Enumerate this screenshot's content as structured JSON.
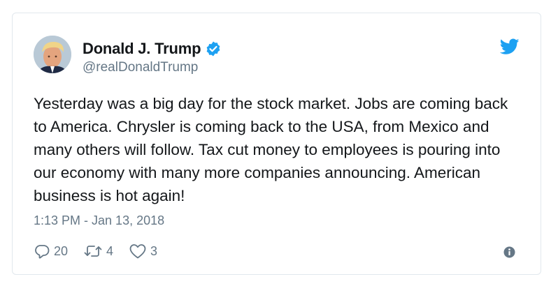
{
  "tweet": {
    "display_name": "Donald J. Trump",
    "handle": "@realDonaldTrump",
    "verified": true,
    "text": "Yesterday was a big day for the stock market. Jobs are coming back to America. Chrysler is coming back to the USA, from Mexico and many others will follow. Tax cut money to employees is pouring into our economy with many more companies announcing. American business is hot again!",
    "timestamp": "1:13 PM - Jan 13, 2018"
  },
  "actions": {
    "reply_count": "20",
    "retweet_count": "4",
    "like_count": "3"
  },
  "icons": {
    "brand": "twitter-bird-icon",
    "verified": "verified-badge-icon",
    "reply": "reply-icon",
    "retweet": "retweet-icon",
    "like": "heart-icon",
    "info": "info-icon"
  },
  "colors": {
    "accent": "#1da1f2",
    "text": "#14171a",
    "muted": "#657786",
    "border": "#e1e8ed"
  }
}
